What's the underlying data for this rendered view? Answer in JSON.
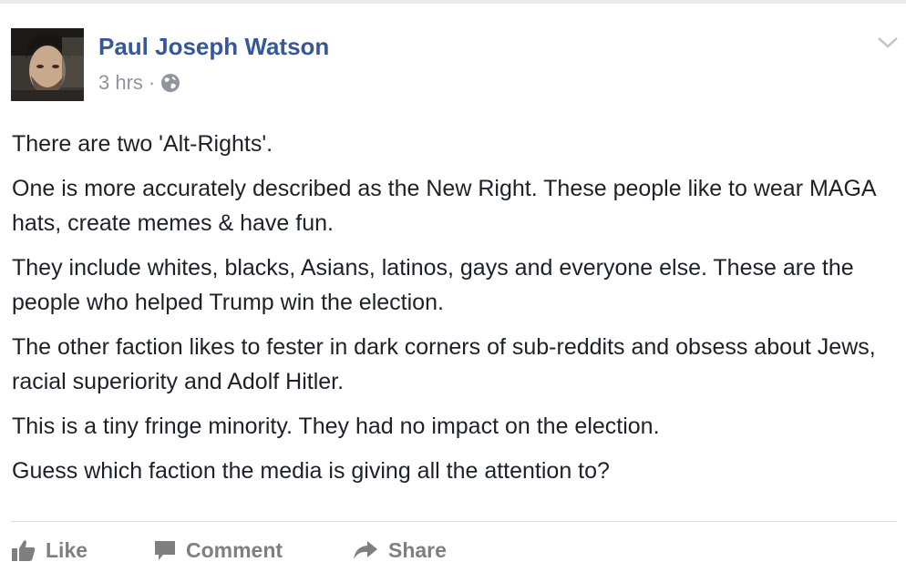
{
  "post": {
    "author": "Paul Joseph Watson",
    "time": "3 hrs",
    "separator": "·",
    "privacy_icon": "globe-icon",
    "menu_icon": "chevron-down-icon",
    "paragraphs": [
      "There are two 'Alt-Rights'.",
      "One is more accurately described as the New Right. These people like to wear MAGA hats, create memes & have fun.",
      "They include whites, blacks, Asians, latinos, gays and everyone else. These are the people who helped Trump win the election.",
      "The other faction likes to fester in dark corners of sub-reddits and obsess about Jews, racial superiority and Adolf Hitler.",
      "This is a tiny fringe minority. They had no impact on the election.",
      "Guess which faction the media is giving all the attention to?"
    ]
  },
  "actions": {
    "like_label": "Like",
    "comment_label": "Comment",
    "share_label": "Share"
  },
  "colors": {
    "author_link": "#365899",
    "meta_text": "#90949c",
    "body_text": "#1d2129",
    "action_text": "#7f7f7f",
    "divider": "#dddfe2"
  }
}
